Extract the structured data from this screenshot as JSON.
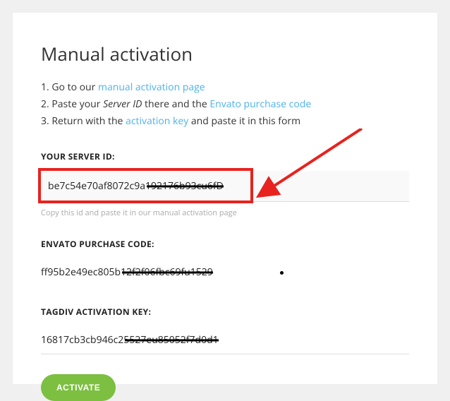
{
  "title": "Manual activation",
  "steps": {
    "s1_prefix": "Go to our ",
    "s1_link": "manual activation page",
    "s2_prefix": "Paste your ",
    "s2_em": "Server ID",
    "s2_mid": " there and the ",
    "s2_link": "Envato purchase code",
    "s3_prefix": "Return with the ",
    "s3_link": "activation key",
    "s3_suffix": " and paste it in this form"
  },
  "server": {
    "label": "YOUR SERVER ID:",
    "value_visible": "be7c54e70af8072c9a1",
    "value_redacted": "92176b93cu6fD",
    "hint": "Copy this id and paste it in our manual activation page"
  },
  "envato": {
    "label": "ENVATO PURCHASE CODE:",
    "value_visible": "ff95b2e49ec805b1",
    "value_redacted": "2f2f06fbc69fu1529"
  },
  "tagdiv": {
    "label": "TAGDIV ACTIVATION KEY:",
    "value_visible": "16817cb3cb946c25",
    "value_redacted": "527eu85052f7d0d1"
  },
  "button": "ACTIVATE"
}
